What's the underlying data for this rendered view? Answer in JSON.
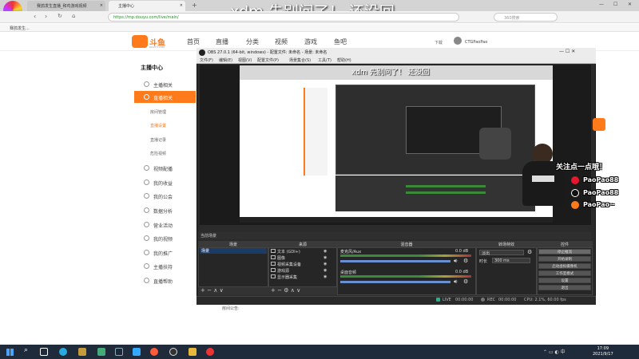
{
  "overlay_title": "xdm 先别问了！ 还没回",
  "browser": {
    "tabs": [
      {
        "label": "赛鸽发生直播_和鸡游戏视频",
        "active": false
      },
      {
        "label": "主播中心",
        "active": true
      }
    ],
    "new_tab": "+",
    "url": "https://mp.douyu.com/live/main/",
    "search_placeholder": "360搜索",
    "bookmark": "赛鸽发生...",
    "profile_label": "下载",
    "user": "CTGPaoPao"
  },
  "douyu": {
    "logo_text": "斗鱼",
    "logo_sub": "DOUYU.COM",
    "nav": [
      "首页",
      "直播",
      "分类",
      "视频",
      "游戏",
      "鱼吧"
    ],
    "sidebar_title": "主播中心",
    "menu": [
      {
        "label": "主播相关",
        "active": false
      },
      {
        "label": "直播相关",
        "active": true
      },
      {
        "label": "视频配播",
        "active": false
      },
      {
        "label": "我的收益",
        "active": false
      },
      {
        "label": "我的公会",
        "active": false
      },
      {
        "label": "数据分析",
        "active": false
      },
      {
        "label": "营业活动",
        "active": false
      },
      {
        "label": "我的视频",
        "active": false
      },
      {
        "label": "我的推广",
        "active": false
      },
      {
        "label": "主播扶持",
        "active": false
      },
      {
        "label": "直播帮助",
        "active": false
      }
    ],
    "submenu": [
      {
        "label": "房间管理",
        "active": false
      },
      {
        "label": "直播设置",
        "active": true
      },
      {
        "label": "直播记录",
        "active": false
      },
      {
        "label": "危险视频",
        "active": false
      }
    ],
    "notice": "房间公告:"
  },
  "obs": {
    "title": "OBS 27.0.1 (64-bit, windows) - 配置文件: 未命名 - 场景: 未命名",
    "menu": [
      "文件(F)",
      "编辑(E)",
      "视图(V)",
      "配置文件(P)",
      "场景集合(S)",
      "工具(T)",
      "帮助(H)"
    ],
    "current_scene": "当前场景",
    "panels": {
      "scenes": "场景",
      "sources": "来源",
      "mixer": "混音器",
      "transitions": "转场特效",
      "controls": "控件"
    },
    "scene_items": [
      "场景"
    ],
    "source_items": [
      "文本 (GDI+)",
      "图像",
      "视频采集设备",
      "游戏源",
      "显示器采集"
    ],
    "mixer_tracks": [
      {
        "name": "麦克风/Aux",
        "db": "0.0 dB"
      },
      {
        "name": "桌面音频",
        "db": "0.0 dB"
      }
    ],
    "transition": {
      "type": "淡出",
      "duration_label": "时长",
      "duration": "300 ms"
    },
    "controls": [
      "停止推流",
      "开始录制",
      "启动虚拟摄像机",
      "工作室模式",
      "设置",
      "退出"
    ],
    "status": {
      "live_label": "LIVE",
      "live_time": "00:00:00",
      "rec_label": "REC",
      "rec_time": "00:00:00",
      "cpu": "CPU: 2.1%, 60.00 fps"
    },
    "preview_title": "xdm 先别问了！ 还没回"
  },
  "stream_overlay": {
    "follow": "关注点一点哦！",
    "socials": [
      "PaoPao88",
      "PaoPao88",
      "PaoPao~"
    ]
  },
  "taskbar": {
    "time": "17:09",
    "date": "2021/9/17"
  }
}
